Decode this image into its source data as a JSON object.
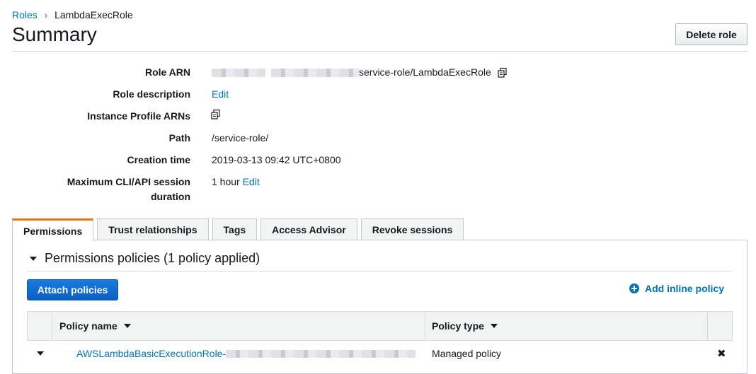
{
  "breadcrumb": {
    "parent": "Roles",
    "separator": "›",
    "current": "LambdaExecRole"
  },
  "page_title": "Summary",
  "delete_role_label": "Delete role",
  "summary": {
    "role_arn": {
      "label": "Role ARN",
      "value_suffix": "service-role/LambdaExecRole",
      "value_obscured": true
    },
    "role_description": {
      "label": "Role description",
      "link": "Edit"
    },
    "instance_profile": {
      "label": "Instance Profile ARNs"
    },
    "path": {
      "label": "Path",
      "value": "/service-role/"
    },
    "creation_time": {
      "label": "Creation time",
      "value": "2019-03-13 09:42 UTC+0800"
    },
    "max_session": {
      "label_line1": "Maximum CLI/API session",
      "label_line2": "duration",
      "value": "1 hour",
      "link": "Edit"
    }
  },
  "tabs": [
    {
      "label": "Permissions",
      "active": true
    },
    {
      "label": "Trust relationships",
      "active": false
    },
    {
      "label": "Tags",
      "active": false
    },
    {
      "label": "Access Advisor",
      "active": false
    },
    {
      "label": "Revoke sessions",
      "active": false
    }
  ],
  "permissions": {
    "section_title": "Permissions policies (1 policy applied)",
    "attach_label": "Attach policies",
    "add_inline_label": "Add inline policy",
    "columns": {
      "policy_name": "Policy name",
      "policy_type": "Policy type"
    },
    "rows": [
      {
        "name_prefix": "AWSLambdaBasicExecutionRole-",
        "name_obscured": true,
        "type": "Managed policy"
      }
    ]
  },
  "icons": {
    "copy": "copy-icon",
    "plus": "plus-circle-icon",
    "remove": "close-icon",
    "caret": "caret-down-icon"
  },
  "colors": {
    "link": "#0073bb",
    "primary_button": "#0b5fc4",
    "active_tab_accent": "#ec7211"
  }
}
